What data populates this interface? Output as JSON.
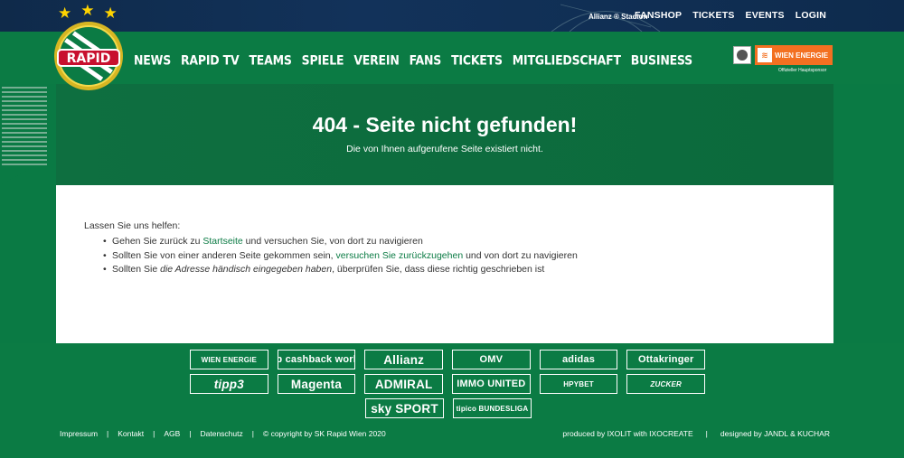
{
  "topbar": {
    "stadium_label": "Allianz ® Stadion",
    "links": [
      "FANSHOP",
      "TICKETS",
      "EVENTS",
      "LOGIN"
    ]
  },
  "logo": {
    "text": "RAPID"
  },
  "nav": {
    "items": [
      "NEWS",
      "RAPID TV",
      "TEAMS",
      "SPIELE",
      "VEREIN",
      "FANS",
      "TICKETS",
      "MITGLIEDSCHAFT",
      "BUSINESS"
    ]
  },
  "sponsor_top": {
    "name": "WIEN ENERGIE",
    "caption": "Offizieller Hauptsponsor"
  },
  "hero": {
    "title": "404 - Seite nicht gefunden!",
    "subtitle": "Die von Ihnen aufgerufene Seite existiert nicht."
  },
  "content": {
    "intro": "Lassen Sie uns helfen:",
    "item1_pre": "Gehen Sie zurück zu ",
    "item1_link": "Startseite",
    "item1_post": " und versuchen Sie, von dort zu navigieren",
    "item2_pre": "Sollten Sie von einer anderen Seite gekommen sein, ",
    "item2_link": "versuchen Sie zurückzugehen",
    "item2_post": " und von dort zu navigieren",
    "item3_pre": "Sollten Sie ",
    "item3_em": "die Adresse händisch eingegeben haben",
    "item3_post": ", überprüfen Sie, dass diese richtig geschrieben ist"
  },
  "footer": {
    "sponsors_row1": [
      "WIEN ENERGIE",
      "cb cashback world",
      "Allianz",
      "OMV",
      "adidas",
      "Ottakringer"
    ],
    "sponsors_row2": [
      "tipp3",
      "Magenta",
      "ADMIRAL",
      "IMMO UNITED",
      "HPYBET",
      "ZUCKER"
    ],
    "sponsors_row3": [
      "sky SPORT",
      "tipico BUNDESLIGA"
    ],
    "legal_links": [
      "Impressum",
      "Kontakt",
      "AGB",
      "Datenschutz"
    ],
    "copyright": "© copyright by SK Rapid Wien 2020",
    "produced_by": "produced by IXOLIT with IXOCREATE",
    "designed_by": "designed by JANDL & KUCHAR"
  },
  "colors": {
    "brand_green": "#0b7b44",
    "accent_yellow": "#ffd400",
    "topbar_navy": "#12325a",
    "wien_energie_orange": "#f37021"
  }
}
